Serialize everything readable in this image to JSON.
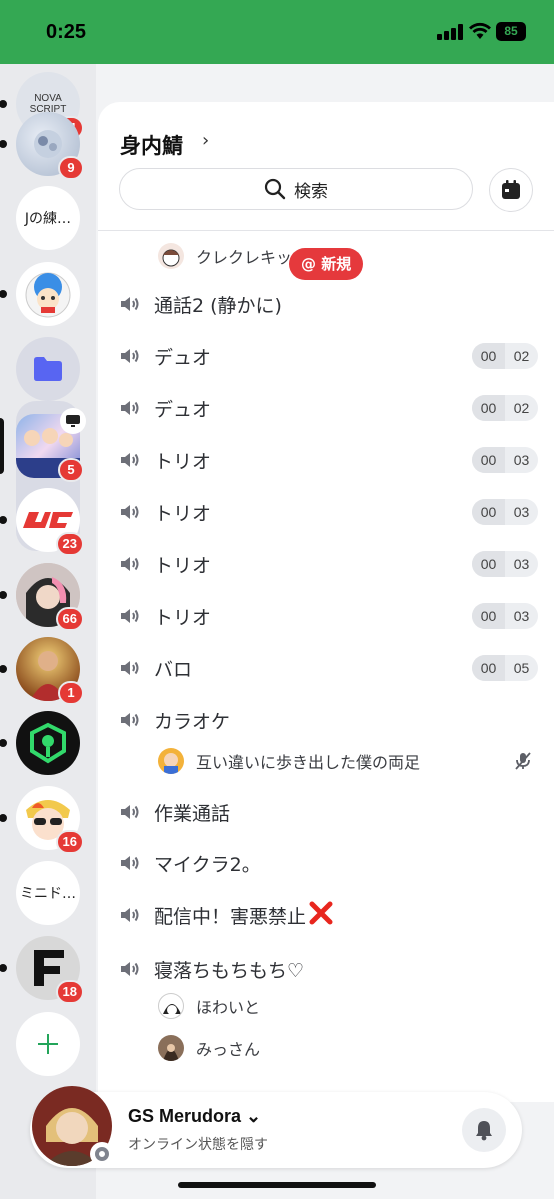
{
  "status_bar": {
    "time": "0:25",
    "battery": "85"
  },
  "servers": [
    {
      "name": "novascript",
      "badge": "21",
      "unread": true,
      "colors": [
        "#dfe3ea",
        "#333"
      ],
      "text": "NOVA SCRIPT"
    },
    {
      "name": "server-2",
      "badge": "9",
      "unread": true
    },
    {
      "name": "text-server-1",
      "text": "Jの練…",
      "unread": false
    },
    {
      "name": "server-4",
      "unread": true
    },
    {
      "name": "folder",
      "unread": false
    },
    {
      "name": "server-6",
      "badge": "5",
      "selected": true
    },
    {
      "name": "server-7",
      "badge": "23",
      "unread": true
    },
    {
      "name": "server-8",
      "badge": "66",
      "unread": true
    },
    {
      "name": "server-9",
      "badge": "1",
      "unread": true
    },
    {
      "name": "server-10",
      "unread": true
    },
    {
      "name": "server-11",
      "badge": "16",
      "unread": true
    },
    {
      "name": "text-server-2",
      "text": "ミニド…",
      "unread": false
    },
    {
      "name": "server-13",
      "badge": "18",
      "unread": true
    }
  ],
  "header": {
    "title": "身内鯖",
    "chevron": "›"
  },
  "search": {
    "label": "検索"
  },
  "new_badge": "@ 新規",
  "channels": [
    {
      "name": "通話2 (静かに)"
    },
    {
      "name": "デュオ",
      "limit": [
        "00",
        "02"
      ]
    },
    {
      "name": "デュオ",
      "limit": [
        "00",
        "02"
      ]
    },
    {
      "name": "トリオ",
      "limit": [
        "00",
        "03"
      ]
    },
    {
      "name": "トリオ",
      "limit": [
        "00",
        "03"
      ]
    },
    {
      "name": "トリオ",
      "limit": [
        "00",
        "03"
      ]
    },
    {
      "name": "トリオ",
      "limit": [
        "00",
        "03"
      ]
    },
    {
      "name": "バロ",
      "limit": [
        "00",
        "05"
      ]
    },
    {
      "name": "カラオケ"
    },
    {
      "name": "作業通話"
    },
    {
      "name": "マイクラ2。"
    },
    {
      "name": "配信中！害悪禁止"
    },
    {
      "name": "寝落ちもちもち♡"
    }
  ],
  "voice_users": {
    "top": "クレクレキッズ",
    "karaoke": "互い違いに歩き出した僕の両足",
    "sleep": [
      "ほわいと",
      "みっさん"
    ]
  },
  "user_bar": {
    "name": "GS Merudora",
    "chevron": "⌄",
    "status": "オンライン状態を隠す"
  },
  "colors": {
    "status_bar": "#34a853",
    "badge": "#e53935",
    "brand": "#5865f2"
  }
}
